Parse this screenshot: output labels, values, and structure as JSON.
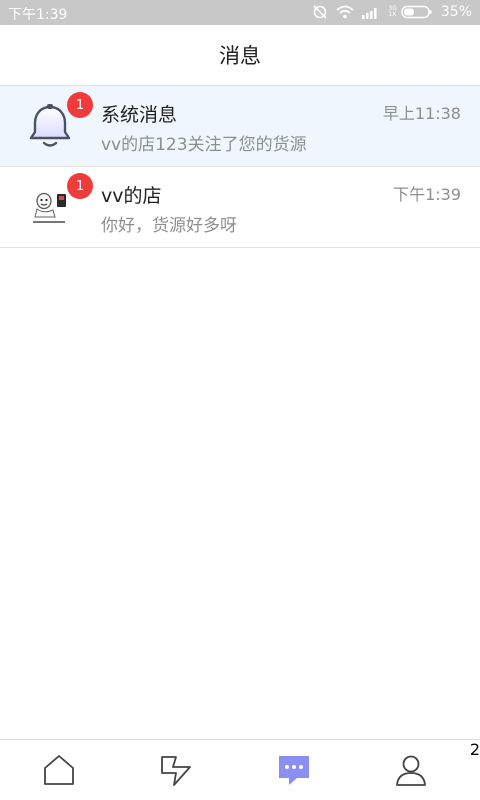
{
  "status_bar": {
    "time": "下午1:39",
    "network_label": "3G",
    "sim_label": "1X",
    "battery_pct": "35%"
  },
  "header": {
    "title": "消息"
  },
  "conversations": [
    {
      "name": "系统消息",
      "preview": "vv的店123关注了您的货源",
      "time": "早上11:38",
      "badge": "1",
      "avatar": "bell-icon"
    },
    {
      "name": "vv的店",
      "preview": "你好，货源好多呀",
      "time": "下午1:39",
      "badge": "1",
      "avatar": "user-avatar"
    }
  ],
  "tab_bar": {
    "items": [
      {
        "name": "home",
        "icon": "home-icon"
      },
      {
        "name": "flash",
        "icon": "lightning-icon"
      },
      {
        "name": "messages",
        "icon": "chat-icon",
        "badge": "2"
      },
      {
        "name": "profile",
        "icon": "person-icon"
      }
    ]
  },
  "colors": {
    "active_row": "#f0f6fd",
    "badge_red": "#ef3b3b",
    "active_tab": "#8c8ff2",
    "muted_text": "#8e8e8e"
  }
}
